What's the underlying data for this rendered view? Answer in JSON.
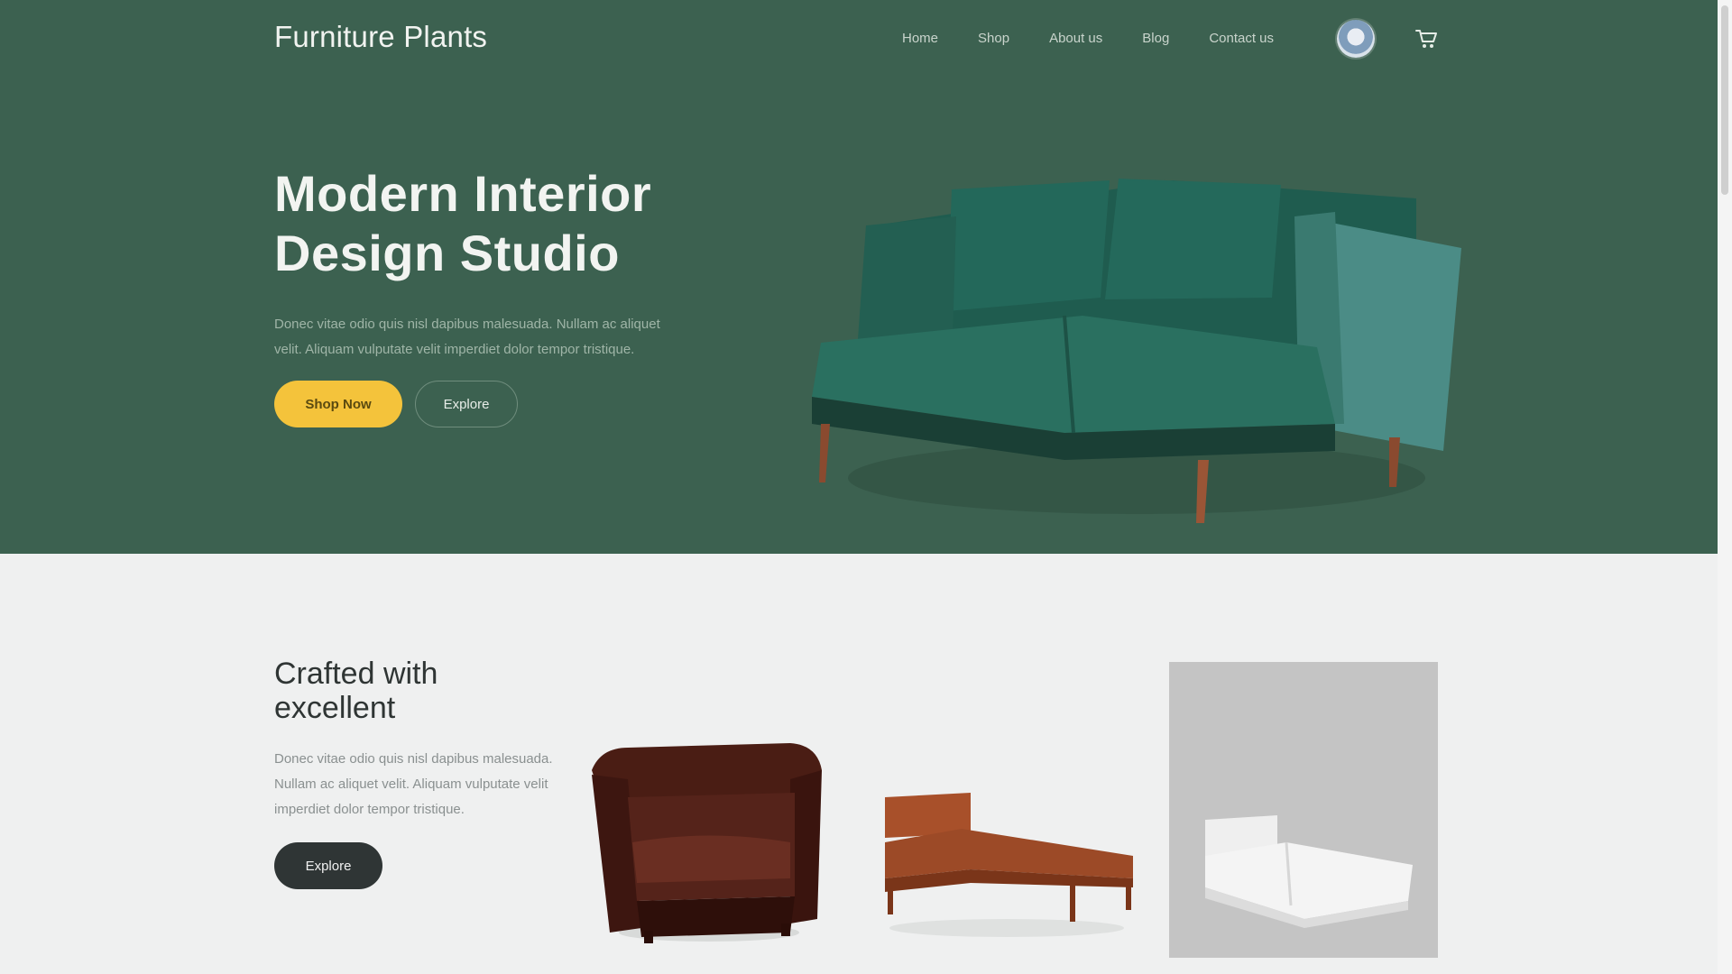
{
  "brand": "Furniture Plants",
  "nav": {
    "items": [
      "Home",
      "Shop",
      "About us",
      "Blog",
      "Contact us"
    ]
  },
  "icons": {
    "avatar": "user-avatar",
    "cart": "cart-icon",
    "sofa": "sofa-image",
    "armchair": "armchair-image",
    "bed": "wooden-bed-image",
    "white_bed": "white-bed-image"
  },
  "hero": {
    "title_line1": "Modern Interior",
    "title_line2": "Design Studio",
    "subtitle": "Donec vitae odio quis nisl dapibus malesuada. Nullam ac aliquet velit. Aliquam vulputate velit imperdiet dolor tempor tristique.",
    "shop_button": "Shop Now",
    "explore_button": "Explore"
  },
  "section": {
    "title": "Crafted with excellent",
    "subtitle": "Donec vitae odio quis nisl dapibus malesuada. Nullam ac aliquet velit. Aliquam vulputate velit imperdiet dolor tempor tristique.",
    "explore_button": "Explore"
  },
  "colors": {
    "hero_bg": "#3c6150",
    "accent": "#f4c33b",
    "dark_button": "#2f3535",
    "page_bg": "#eff0f0"
  }
}
